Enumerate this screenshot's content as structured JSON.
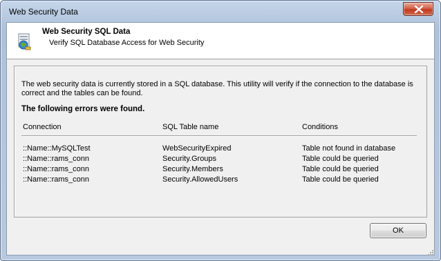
{
  "window": {
    "title": "Web Security Data"
  },
  "header": {
    "title": "Web Security SQL Data",
    "subtitle": "Verify SQL Database Access for Web Security",
    "icon": "database-globe-icon"
  },
  "body": {
    "description": "The web security data is currently stored in a SQL database. This utility will verify if the connection to the database is correct and the tables can be found.",
    "error_heading": "The following errors were found.",
    "columns": {
      "connection": "Connection",
      "table": "SQL Table name",
      "conditions": "Conditions"
    },
    "rows": [
      {
        "connection": "::Name::MySQLTest",
        "table": "WebSecurityExpired",
        "condition": "Table not found in database"
      },
      {
        "connection": "::Name::rams_conn",
        "table": "Security.Groups",
        "condition": "Table could be queried"
      },
      {
        "connection": "::Name::rams_conn",
        "table": "Security.Members",
        "condition": "Table could be queried"
      },
      {
        "connection": "::Name::rams_conn",
        "table": "Security.AllowedUsers",
        "condition": "Table could be queried"
      }
    ]
  },
  "buttons": {
    "ok_label": "OK"
  },
  "colors": {
    "close_button": "#c8452c",
    "titlebar": "#b9cbe2",
    "dialog_bg": "#f0f0f0"
  }
}
